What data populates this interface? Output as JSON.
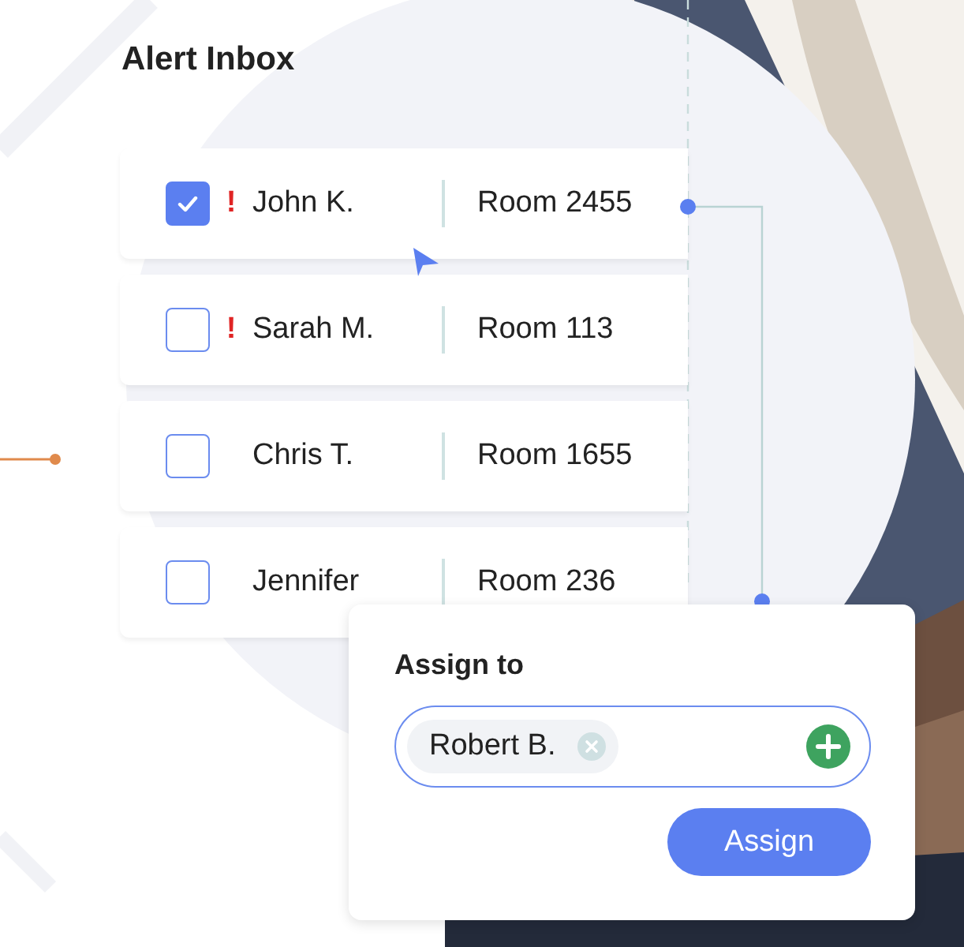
{
  "title": "Alert Inbox",
  "alerts": [
    {
      "name": "John K.",
      "room": "Room 2455",
      "checked": true,
      "flag": "!"
    },
    {
      "name": "Sarah M.",
      "room": "Room 113",
      "checked": false,
      "flag": "!"
    },
    {
      "name": "Chris T.",
      "room": "Room 1655",
      "checked": false
    },
    {
      "name": "Jennifer",
      "room": "Room 236",
      "checked": false
    }
  ],
  "assign_panel": {
    "title": "Assign to",
    "chips": [
      {
        "label": "Robert B."
      }
    ],
    "button": "Assign"
  }
}
